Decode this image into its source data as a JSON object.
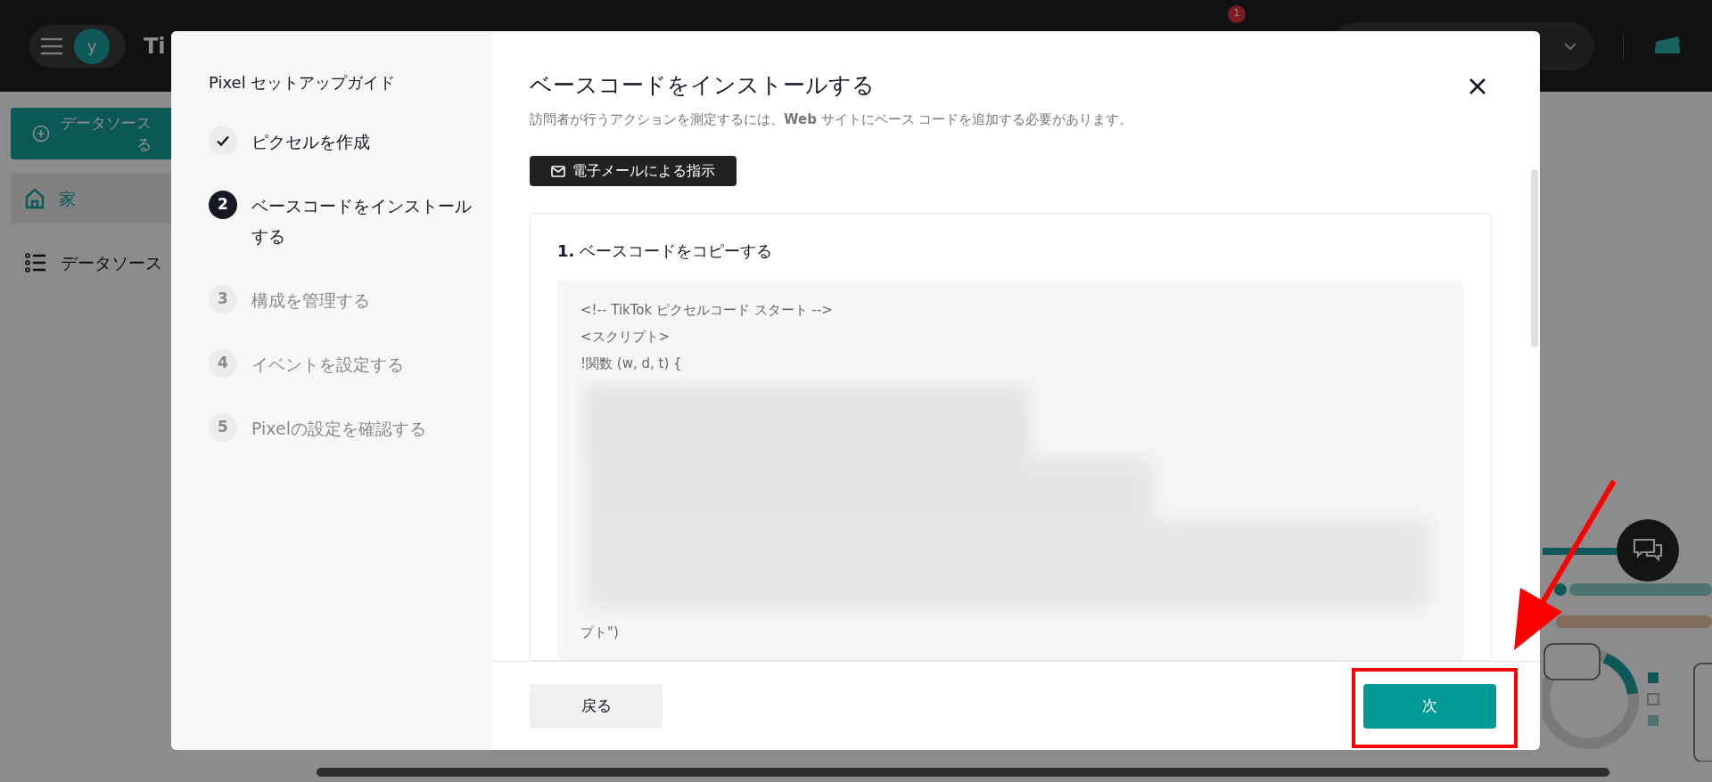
{
  "topbar": {
    "avatar": "y",
    "brand": "Ti",
    "notification_badge": "1"
  },
  "sidebar": {
    "create_button": [
      "データソース",
      "る"
    ],
    "items": [
      {
        "label": "家",
        "kind": "home",
        "selected": true
      },
      {
        "label": "データソース",
        "kind": "list",
        "selected": false
      }
    ]
  },
  "modal": {
    "guide_title": "Pixel セットアップガイド",
    "steps": [
      {
        "completed": true,
        "selected": false,
        "label": "ピクセルを作成"
      },
      {
        "completed": false,
        "selected": true,
        "number": "2",
        "label": "ベースコードをインストールする"
      },
      {
        "completed": false,
        "selected": false,
        "number": "3",
        "label": "構成を管理する"
      },
      {
        "completed": false,
        "selected": false,
        "number": "4",
        "label": "イベントを設定する"
      },
      {
        "completed": false,
        "selected": false,
        "number": "5",
        "label": "Pixelの設定を確認する"
      }
    ],
    "title": "ベースコードをインストールする",
    "description": "訪問者が行うアクションを測定するには、**Web** サイトにベース コードを追加する必要があります。",
    "email_button": "電子メールによる指示",
    "section_title": "**1.** ベースコードをコピーする",
    "code_lines": [
      "<!-- TikTok ピクセルコード スタート -->",
      "<スクリプト>",
      "!関数 (w, d, t) {"
    ],
    "code_tail": "プト\")",
    "back_button": "戻る",
    "next_button": "次"
  }
}
